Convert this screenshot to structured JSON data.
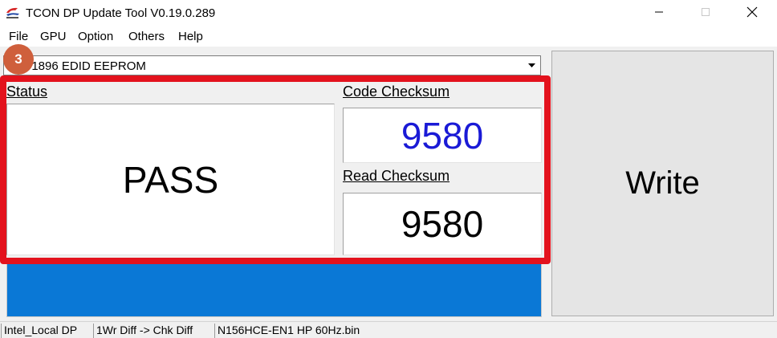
{
  "window": {
    "title": "TCON DP Update Tool V0.19.0.289",
    "app_icon": "tcon-app-icon",
    "controls": {
      "minimize": "minimize-icon",
      "maximize": "maximize-icon",
      "close": "close-icon"
    }
  },
  "menu": {
    "items": [
      "File",
      "GPU",
      "Option",
      "Others",
      "Help"
    ]
  },
  "device_select": {
    "value": "71896 EDID EEPROM"
  },
  "step_badge": "3",
  "status": {
    "label": "Status",
    "value": "PASS"
  },
  "code_checksum": {
    "label": "Code Checksum",
    "value": "9580",
    "color": "#1a1ad6"
  },
  "read_checksum": {
    "label": "Read Checksum",
    "value": "9580"
  },
  "progress": {
    "fraction": 1.0,
    "color": "#0a78d6"
  },
  "write_button": {
    "label": "Write"
  },
  "highlight_color": "#e3121d",
  "statusbar": {
    "panes": [
      "Intel_Local DP",
      "1Wr Diff -> Chk Diff",
      "N156HCE-EN1 HP 60Hz.bin"
    ]
  }
}
